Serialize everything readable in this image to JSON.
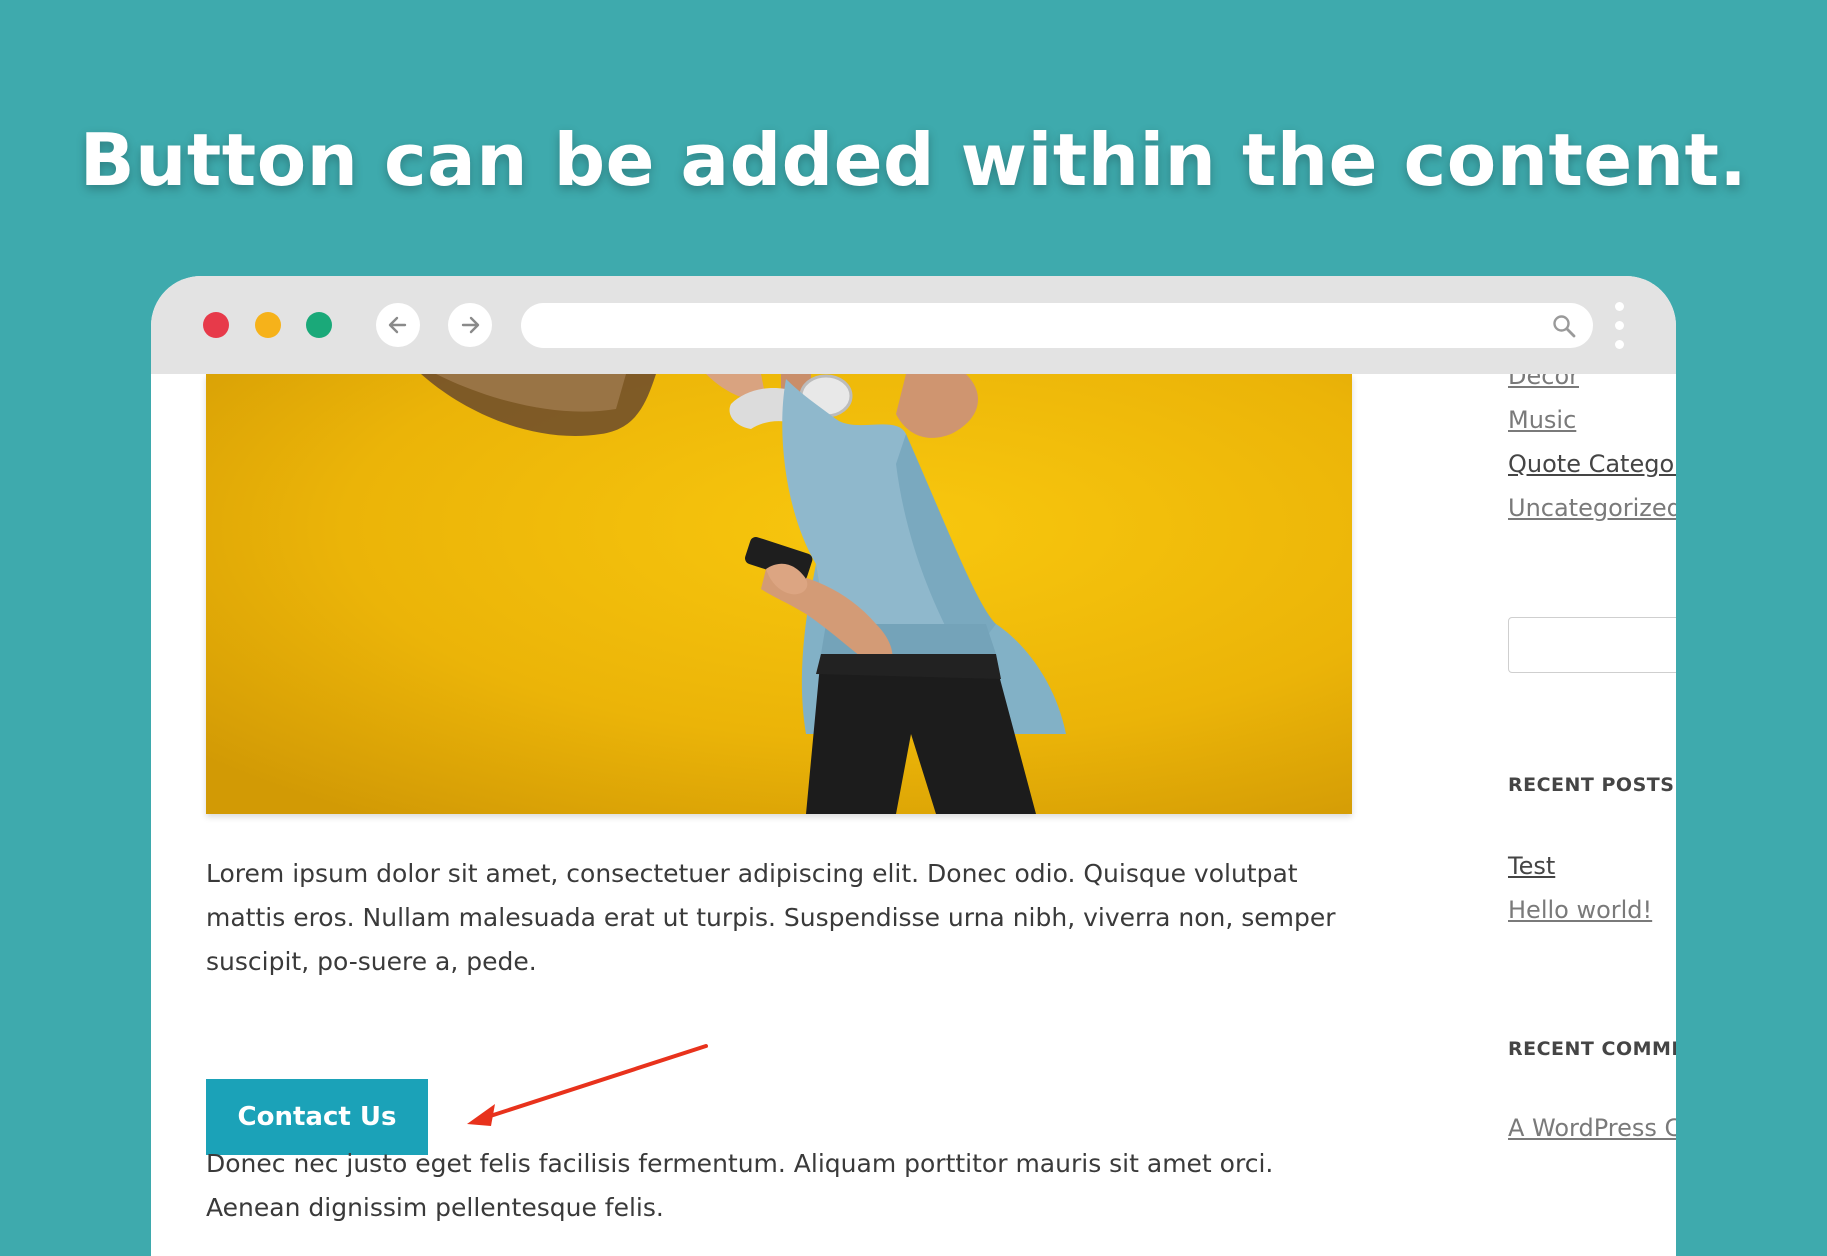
{
  "headline": "Button can be added within the content.",
  "colors": {
    "background": "#3eaaad",
    "button": "#1ba2b8",
    "arrow": "#e8321c",
    "traffic_red": "#e73a4a",
    "traffic_yellow": "#f6b21a",
    "traffic_green": "#1aa979"
  },
  "browser": {
    "icons": {
      "back": "arrow-left-icon",
      "forward": "arrow-right-icon",
      "search": "search-icon",
      "menu": "kebab-menu-icon"
    }
  },
  "main": {
    "paragraph_1": "Lorem ipsum dolor sit amet, consectetuer adipiscing elit. Donec odio. Quisque volutpat mattis eros. Nullam malesuada erat ut turpis. Suspendisse urna nibh, viverra non, semper suscipit, po-suere a, pede.",
    "button_label": "Contact Us",
    "paragraph_2": "Donec nec justo eget felis facilisis fermentum. Aliquam porttitor mauris sit amet orci. Aenean dignissim pellentesque felis."
  },
  "sidebar": {
    "categories": [
      "Decor",
      "Music",
      "Quote Category",
      "Uncategorized"
    ],
    "recent_posts_heading": "RECENT POSTS",
    "recent_posts": [
      "Test",
      "Hello world!"
    ],
    "recent_comments_heading": "RECENT COMMENTS",
    "recent_comments": [
      "A WordPress Commenter"
    ]
  }
}
